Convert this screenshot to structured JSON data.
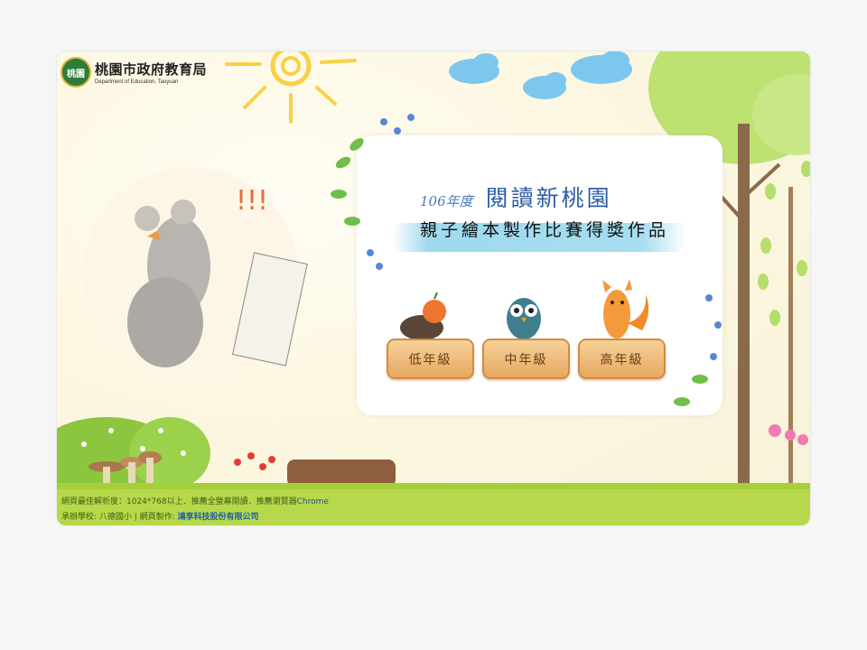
{
  "header": {
    "logo_title": "桃園市政府教育局",
    "logo_subtitle": "Department of Education, Taoyuan",
    "seal_text": "桃園"
  },
  "card": {
    "year": "106年度",
    "brand": "閱讀新桃園",
    "subtitle": "親子繪本製作比賽得獎作品"
  },
  "grades": [
    {
      "label": "低年級",
      "animal": "hedgehog-icon"
    },
    {
      "label": "中年級",
      "animal": "owl-icon"
    },
    {
      "label": "高年級",
      "animal": "fox-icon"
    }
  ],
  "footer": {
    "line1_prefix": "網頁最佳解析度：1024*768以上．推薦全螢幕閱讀．推薦瀏覽器",
    "line1_browser": "Chrome",
    "line2_prefix": "承辦學校: 八德國小 | 網頁製作: ",
    "line2_company": "鴻享科技股份有限公司"
  },
  "colors": {
    "footer_bg": "#b7d84a",
    "button_bg": "#e6a862",
    "brand_blue": "#2f5ea5",
    "page_bg": "#f6f6f6"
  }
}
